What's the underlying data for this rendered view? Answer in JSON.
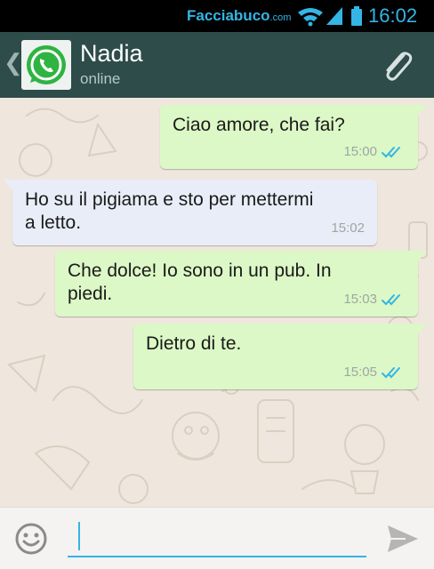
{
  "status_bar": {
    "brand_main": "Facciabuco",
    "brand_suffix": ".com",
    "time": "16:02",
    "icons": [
      "wifi-icon",
      "signal-icon",
      "battery-icon"
    ],
    "accent_color": "#33b5e5"
  },
  "header": {
    "back_icon": "chevron-left-icon",
    "avatar_icon": "whatsapp-logo",
    "contact_name": "Nadia",
    "contact_status": "online",
    "attach_icon": "paperclip-icon",
    "background_color": "#2d4c4a"
  },
  "messages": [
    {
      "direction": "outgoing",
      "text_lines": [
        "Ciao amore, che fai?"
      ],
      "time": "15:00",
      "read": true
    },
    {
      "direction": "incoming",
      "text_lines": [
        "Ho su il pigiama e sto per mettermi",
        "a letto."
      ],
      "time": "15:02"
    },
    {
      "direction": "outgoing",
      "text_lines": [
        "Che dolce! Io sono in un pub. In",
        "piedi."
      ],
      "time": "15:03",
      "read": true
    },
    {
      "direction": "outgoing",
      "text_lines": [
        "Dietro di te."
      ],
      "time": "15:05",
      "read": true
    }
  ],
  "composer": {
    "emoji_icon": "smiley-icon",
    "input_value": "",
    "send_icon": "send-arrow-icon"
  },
  "colors": {
    "outgoing_bubble": "#dcf8c6",
    "incoming_bubble": "#e9edf8",
    "read_ticks": "#33b5e5",
    "chat_background": "#efe7dd"
  }
}
